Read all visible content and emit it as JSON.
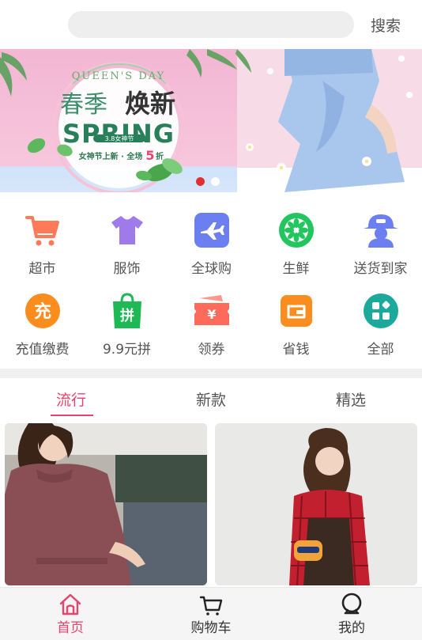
{
  "search": {
    "placeholder": "",
    "value": "",
    "button_label": "搜索"
  },
  "banner": {
    "badge_small": "QUEEN'S DAY",
    "title_cn_1": "春季",
    "title_cn_2": "焕新",
    "title_en": "SPRING",
    "sub_tag": "3.8女神节",
    "promo_prefix": "女神节上新 · 全场",
    "promo_number": "5",
    "promo_suffix": "折",
    "slides": 2,
    "active_slide": 1
  },
  "categories": [
    {
      "label": "超市",
      "icon": "shopping-cart-icon",
      "color": "#ff7a59"
    },
    {
      "label": "服饰",
      "icon": "tshirt-icon",
      "color": "#9f7aea"
    },
    {
      "label": "全球购",
      "icon": "airplane-icon",
      "color": "#6b7ff0"
    },
    {
      "label": "生鲜",
      "icon": "lime-slice-icon",
      "color": "#22c55e"
    },
    {
      "label": "送货到家",
      "icon": "courier-icon",
      "color": "#6b7ff0"
    },
    {
      "label": "充值缴费",
      "icon": "recharge-icon",
      "color": "#fb8c1e"
    },
    {
      "label": "9.9元拼",
      "icon": "group-buy-bag-icon",
      "color": "#1db954"
    },
    {
      "label": "领券",
      "icon": "coupon-icon",
      "color": "#ff6b5b"
    },
    {
      "label": "省钱",
      "icon": "wallet-icon",
      "color": "#fb8c1e"
    },
    {
      "label": "全部",
      "icon": "all-grid-icon",
      "color": "#1aa99a"
    }
  ],
  "tabs": [
    {
      "label": "流行",
      "active": true
    },
    {
      "label": "新款",
      "active": false
    },
    {
      "label": "精选",
      "active": false
    }
  ],
  "products": [
    {
      "alt": "pink knit outfit",
      "bg": "#c9c4bf"
    },
    {
      "alt": "red plaid shirt outfit",
      "bg": "#e9e9e7"
    }
  ],
  "nav": [
    {
      "label": "首页",
      "icon": "home-icon",
      "active": true
    },
    {
      "label": "购物车",
      "icon": "cart-icon",
      "active": false
    },
    {
      "label": "我的",
      "icon": "profile-icon",
      "active": false
    }
  ],
  "colors": {
    "accent": "#e8436e",
    "dot_active": "#e03131"
  }
}
